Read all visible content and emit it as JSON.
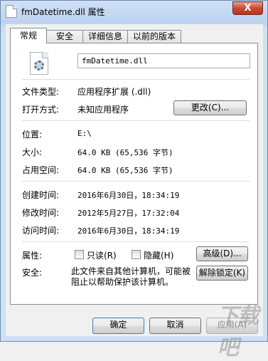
{
  "window": {
    "title": "fmDatetime.dll 属性",
    "close_label": "X"
  },
  "tabs": [
    {
      "label": "常规"
    },
    {
      "label": "安全"
    },
    {
      "label": "详细信息"
    },
    {
      "label": "以前的版本"
    }
  ],
  "general": {
    "file_name": "fmDatetime.dll",
    "file_type_label": "文件类型:",
    "file_type_value": "应用程序扩展 (.dll)",
    "open_with_label": "打开方式:",
    "open_with_value": "未知应用程序",
    "change_button": "更改(C)...",
    "location_label": "位置:",
    "location_value": "E:\\",
    "size_label": "大小:",
    "size_value": "64.0 KB (65,536 字节)",
    "size_on_disk_label": "占用空间:",
    "size_on_disk_value": "64.0 KB (65,536 字节)",
    "created_label": "创建时间:",
    "created_value": "2016年6月30日，18:34:19",
    "modified_label": "修改时间:",
    "modified_value": "2012年5月27日，17:32:04",
    "accessed_label": "访问时间:",
    "accessed_value": "2016年6月30日，18:34:19",
    "attributes_label": "属性:",
    "readonly_label": "只读(R)",
    "hidden_label": "隐藏(H)",
    "advanced_button": "高级(D)...",
    "security_label": "安全:",
    "security_text": "此文件来自其他计算机，可能被阻止以帮助保护该计算机。",
    "unblock_button": "解除锁定(K)"
  },
  "footer": {
    "ok": "确定",
    "cancel": "取消",
    "apply": "应用(A)"
  },
  "watermark": "下载吧",
  "icons": [
    "file-icon",
    "dll-gear-icon",
    "title-file-icon",
    "close-icon"
  ]
}
